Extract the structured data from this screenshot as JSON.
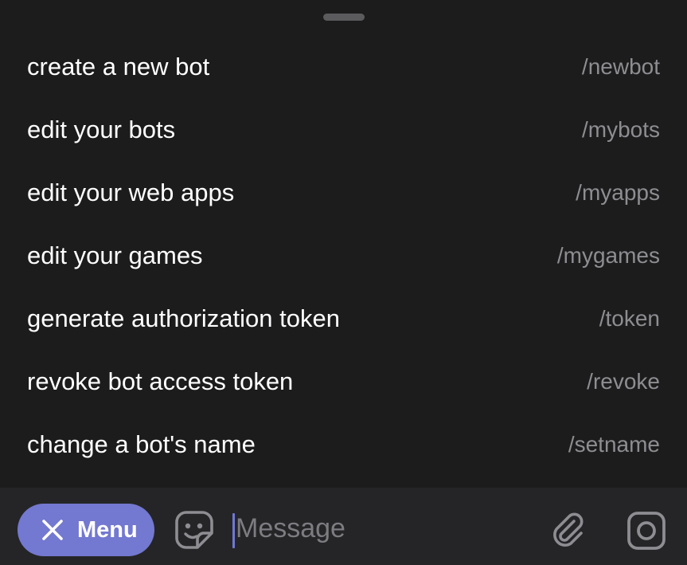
{
  "commands": [
    {
      "description": "create a new bot",
      "command": "/newbot"
    },
    {
      "description": "edit your bots",
      "command": "/mybots"
    },
    {
      "description": "edit your web apps",
      "command": "/myapps"
    },
    {
      "description": "edit your games",
      "command": "/mygames"
    },
    {
      "description": "generate authorization token",
      "command": "/token"
    },
    {
      "description": "revoke bot access token",
      "command": "/revoke"
    },
    {
      "description": "change a bot's name",
      "command": "/setname"
    }
  ],
  "composer": {
    "menu_label": "Menu",
    "message_placeholder": "Message",
    "menu_icon": "close-icon",
    "sticker_icon": "sticker-icon",
    "attach_icon": "paperclip-icon",
    "camera_icon": "camera-icon"
  },
  "colors": {
    "background": "#1c1c1d",
    "composer_background": "#252527",
    "accent": "#7378d0",
    "command_text": "#8d8d92",
    "primary_text": "#ffffff"
  }
}
